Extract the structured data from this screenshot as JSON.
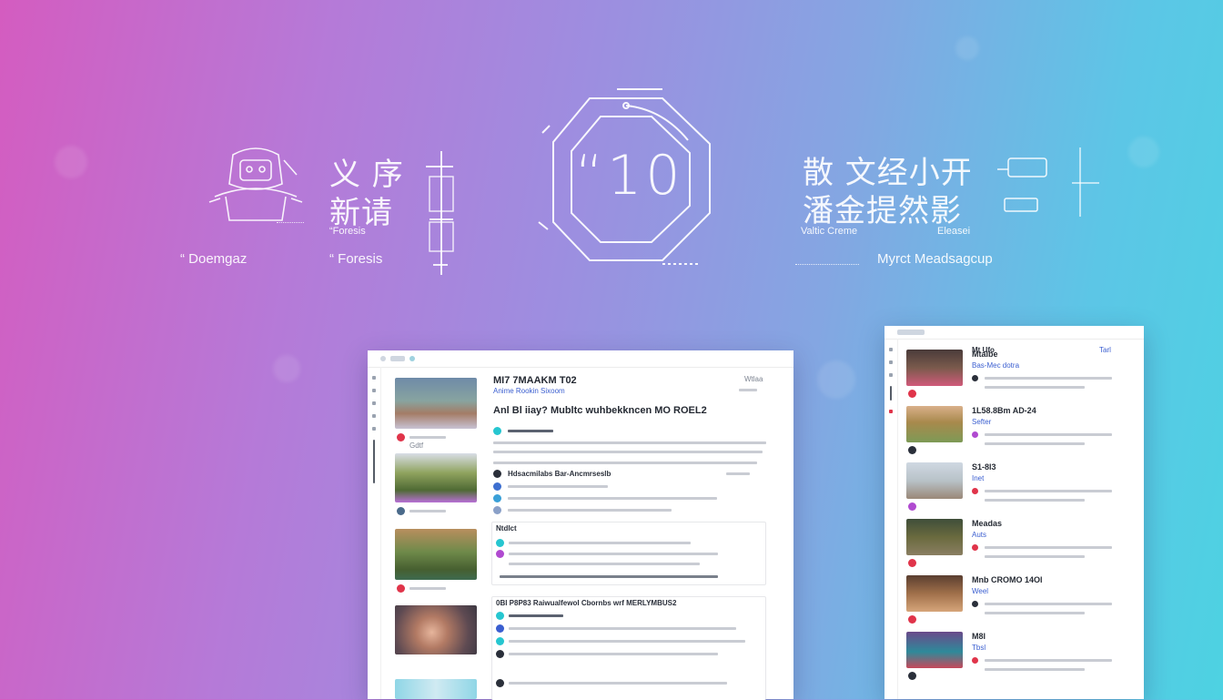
{
  "hero": {
    "left_cjk_line1": "义 序",
    "left_cjk_line2": "新请",
    "left_caption": "“ Doemgaz",
    "left_sub_caption": "“ Foresis",
    "left_tiny_label": "“Foresis",
    "center_badge_text": "“10",
    "right_cjk_line1": "散 文经小开",
    "right_cjk_line2": "潘金提然影",
    "right_tiny_left": "Valtic Creme",
    "right_tiny_right": "Eleasei",
    "right_caption": "Myrct Meadsagcup"
  },
  "left_window": {
    "header_title": "MI7 7MAAKM T02",
    "header_link": "Anime Rookin Sixoom",
    "headline": "Anl Bl iiay? Mubltc wuhbekkncen MO ROEL2",
    "section_title_1": "Hdsacmilabs Bar-Ancmrseslb",
    "section_title_2": "Ntdlct",
    "section_title_3": "0Bl P8P83 Raiwualfewol Cbornbs wrf MERLYMBUS2",
    "top_right_label": "Wtlaa",
    "side_label": "Gdtf"
  },
  "right_window": {
    "items": [
      {
        "title": "Mtalbe",
        "meta": "Bas-Mec dotra"
      },
      {
        "title": "1L58.8Bm AD-24",
        "meta": "Sefter"
      },
      {
        "title": "S1-8l3",
        "meta": "Inet"
      },
      {
        "title": "Meadas",
        "meta": "Auts"
      },
      {
        "title": "Mnb CROMO 14Ol",
        "meta": "Weel"
      },
      {
        "title": "M8l",
        "meta": "Tbsl"
      }
    ],
    "header_label": "Mt Ufo",
    "header_right": "Tarl"
  },
  "colors": {
    "gradient_left": "#d45cc0",
    "gradient_mid": "#9d8ee0",
    "gradient_right": "#4dd2e2",
    "window_bg": "#ffffff",
    "accent_teal": "#26c6d0",
    "accent_red": "#e0344a",
    "accent_purple": "#b04ad0"
  }
}
